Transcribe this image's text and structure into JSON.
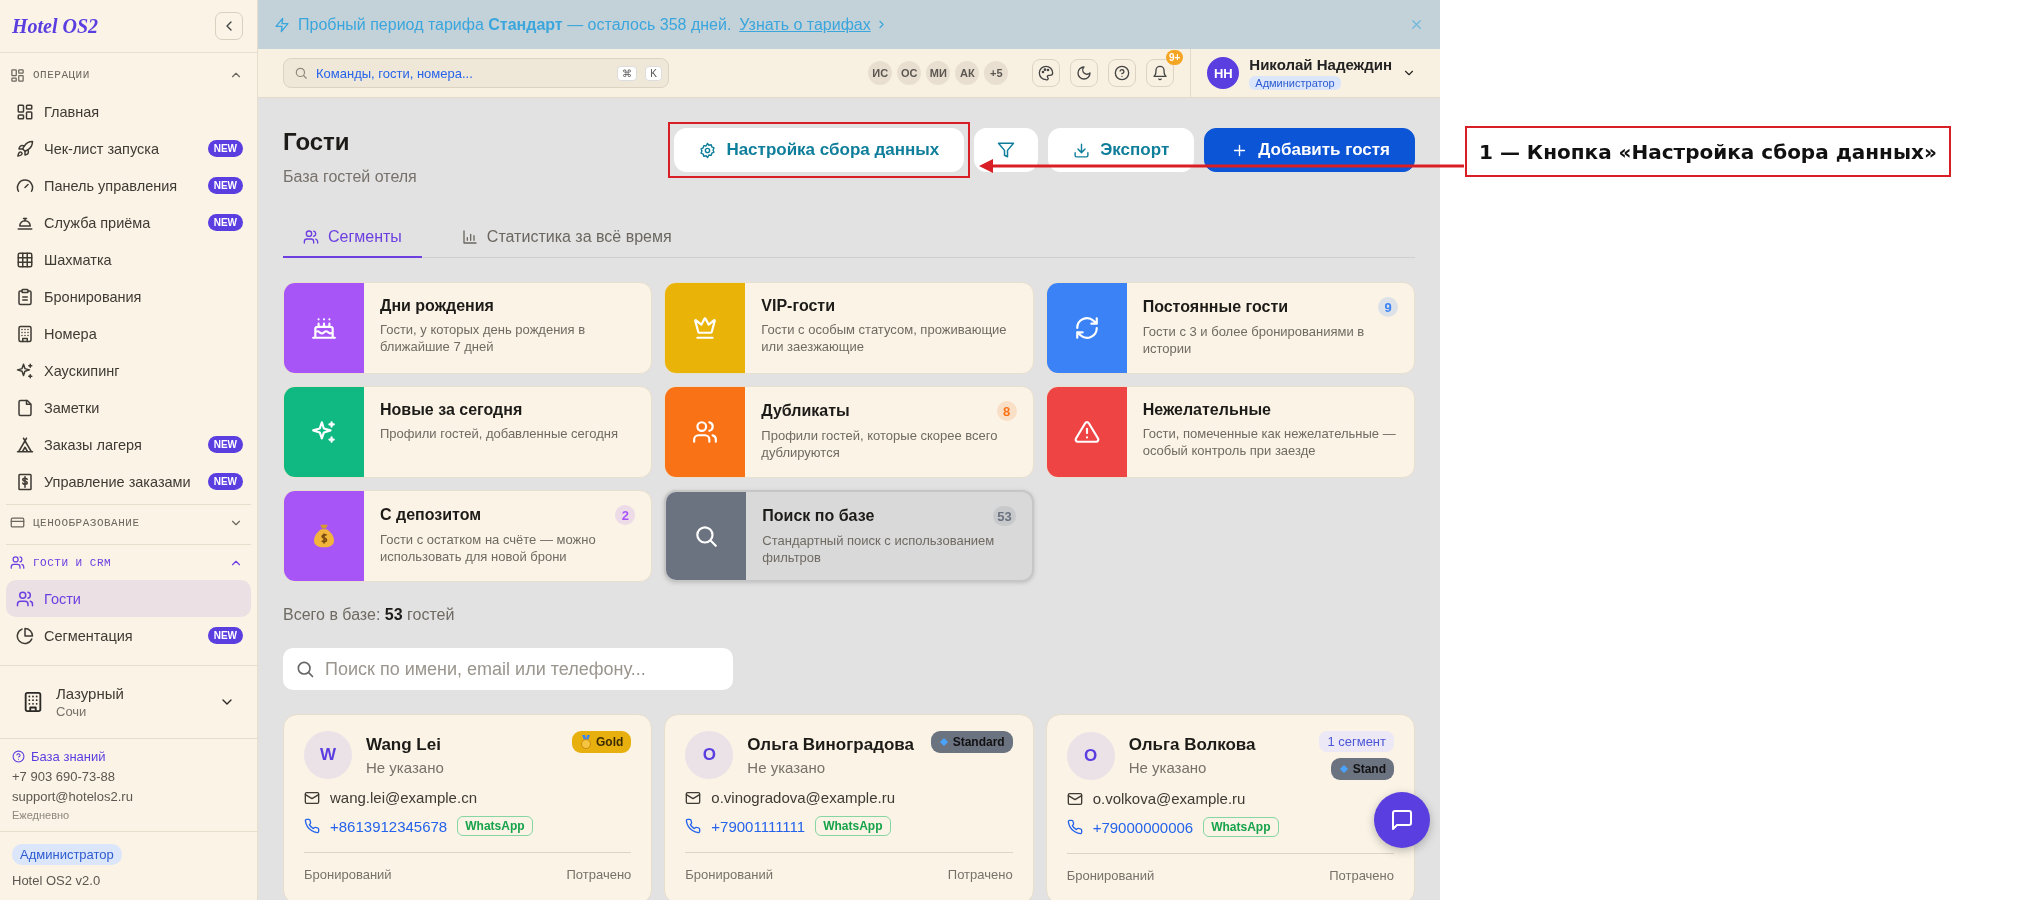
{
  "banner": {
    "text": "Пробный период тарифа **Стандарт** — осталось 358 дней.",
    "link": "Узнать о тарифах"
  },
  "sidebar": {
    "logo": "Hotel OS2",
    "sections": [
      {
        "title": "ОПЕРАЦИИ",
        "expanded": true,
        "active": false,
        "items": [
          {
            "label": "Главная",
            "selected": false
          },
          {
            "label": "Чек-лист запуска",
            "badge": "NEW",
            "selected": false
          },
          {
            "label": "Панель управления",
            "badge": "NEW",
            "selected": false
          },
          {
            "label": "Служба приёма",
            "badge": "NEW",
            "selected": false
          },
          {
            "label": "Шахматка",
            "selected": false
          },
          {
            "label": "Бронирования",
            "selected": false
          },
          {
            "label": "Номера",
            "selected": false
          },
          {
            "label": "Хаускипинг",
            "selected": false
          },
          {
            "label": "Заметки",
            "selected": false
          },
          {
            "label": "Заказы лагеря",
            "badge": "NEW",
            "selected": false
          },
          {
            "label": "Управление заказами",
            "badge": "NEW",
            "selected": false
          }
        ]
      },
      {
        "title": "ЦЕНООБРАЗОВАНИЕ",
        "expanded": false,
        "active": false
      },
      {
        "title": "ГОСТИ И CRM",
        "expanded": true,
        "active": true,
        "items": [
          {
            "label": "Гости",
            "selected": true
          },
          {
            "label": "Сегментация",
            "badge": "NEW",
            "selected": false
          }
        ]
      }
    ],
    "hotel": {
      "name": "Лазурный",
      "city": "Сочи"
    },
    "support": {
      "link": "База знаний",
      "phone": "+7 903 690-73-88",
      "email": "support@hotelos2.ru",
      "hours": "Ежедневно"
    },
    "role": "Администратор",
    "version": "Hotel OS2 v2.0"
  },
  "header": {
    "search_placeholder": "Команды, гости, номера...",
    "shortcut": [
      "⌘",
      "K"
    ],
    "team": [
      "ИС",
      "ОС",
      "МИ",
      "АК",
      "+5"
    ],
    "notifications": "9+",
    "user": {
      "initials": "НН",
      "name": "Николай Надеждин",
      "role": "Администратор"
    }
  },
  "page": {
    "title": "Гости",
    "subtitle": "База гостей отеля",
    "settings": "Настройка сбора данных",
    "export": "Экспорт",
    "add": "Добавить гостя"
  },
  "tabs": [
    {
      "label": "Сегменты",
      "selected": true
    },
    {
      "label": "Статистика за всё время",
      "selected": false
    }
  ],
  "segments": [
    {
      "title": "Дни рождения",
      "description": "Гости, у которых день рождения в ближайшие 7 дней",
      "color": "#a855f7",
      "selected": false
    },
    {
      "title": "VIP-гости",
      "description": "Гости с особым статусом, проживающие или заезжающие",
      "color": "#eab308",
      "selected": false
    },
    {
      "title": "Постоянные гости",
      "description": "Гости с 3 и более бронированиями в истории",
      "color": "#3b82f6",
      "count": "9",
      "selected": false
    },
    {
      "title": "Новые за сегодня",
      "description": "Профили гостей, добавленные сегодня",
      "color": "#10b981",
      "selected": false
    },
    {
      "title": "Дубликаты",
      "description": "Профили гостей, которые скорее всего дублируются",
      "color": "#f97316",
      "count": "8",
      "selected": false
    },
    {
      "title": "Нежелательные",
      "description": "Гости, помеченные как нежелательные — особый контроль при заезде",
      "color": "#ef4444",
      "selected": false
    },
    {
      "title": "С депозитом",
      "description": "Гости с остатком на счёте — можно использовать для новой брони",
      "color": "#a855f7",
      "count": "2",
      "selected": false
    },
    {
      "title": "Поиск по базе",
      "description": "Стандартный поиск с использованием фильтров",
      "color": "#6b7280",
      "count": "53",
      "selected": true
    }
  ],
  "total": "Всего в базе: **53** гостей",
  "guest_search": {
    "placeholder": "Поиск по имени, email или телефону..."
  },
  "guests": [
    {
      "initial": "W",
      "name": "Wang Lei",
      "status": "Не указано",
      "tier": {
        "kind": "gold",
        "label": "Gold"
      },
      "email": "wang.lei@example.cn",
      "phone": "+8613912345678",
      "messenger": "WhatsApp",
      "stats": [
        "Бронирований",
        "Потрачено"
      ]
    },
    {
      "initial": "О",
      "name": "Ольга Виноградова",
      "status": "Не указано",
      "tier": {
        "kind": "standard",
        "label": "Standard"
      },
      "email": "o.vinogradova@example.ru",
      "phone": "+79001111111",
      "messenger": "WhatsApp",
      "stats": [
        "Бронирований",
        "Потрачено"
      ]
    },
    {
      "initial": "О",
      "name": "Ольга Волкова",
      "status": "Не указано",
      "segments": "1 сегмент",
      "tier": {
        "kind": "standard",
        "label": "Stand"
      },
      "email": "o.volkova@example.ru",
      "phone": "+79000000006",
      "messenger": "WhatsApp",
      "stats": [
        "Бронирований",
        "Потрачено"
      ]
    }
  ],
  "annotation": {
    "label": "1 — Кнопка «Настройка сбора данных»"
  }
}
